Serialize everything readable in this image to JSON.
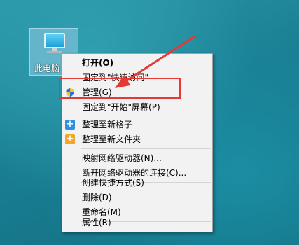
{
  "desktop": {
    "icon_label": "此电脑"
  },
  "context_menu": {
    "items": [
      {
        "label": "打开(O)",
        "bold": true
      },
      {
        "label": "固定到\"快速访问\""
      },
      {
        "label": "管理(G)",
        "icon": "shield-icon"
      },
      {
        "label": "固定到\"开始\"屏幕(P)"
      },
      {
        "label": "整理至新格子",
        "icon": "plus-icon"
      },
      {
        "label": "整理至新文件夹",
        "icon": "plus-icon"
      },
      {
        "label": "映射网络驱动器(N)..."
      },
      {
        "label": "断开网络驱动器的连接(C)..."
      },
      {
        "label": "创建快捷方式(S)"
      },
      {
        "label": "删除(D)"
      },
      {
        "label": "重命名(M)"
      },
      {
        "label": "属性(R)"
      }
    ]
  },
  "colors": {
    "annotation_red": "#e53935",
    "plus_blue": "#2f8fe0",
    "plus_orange": "#f5a623"
  }
}
